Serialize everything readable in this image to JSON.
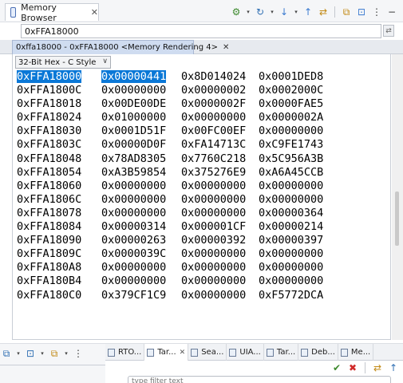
{
  "view": {
    "title": "Memory Browser",
    "close": "✕"
  },
  "address": {
    "value": "0xFFA18000"
  },
  "rendering_tab": {
    "label": "0xffa18000 - 0xFFA18000 <Memory Rendering 4>",
    "close": "✕"
  },
  "format": {
    "selected": "32-Bit Hex - C Style",
    "arrow": "∨"
  },
  "memory": {
    "rows": [
      {
        "addr": "0xFFA18000",
        "w0": "0x00000441",
        "w1": "0x8D014024",
        "w2": "0x0001DED8"
      },
      {
        "addr": "0xFFA1800C",
        "w0": "0x00000000",
        "w1": "0x00000002",
        "w2": "0x0002000C"
      },
      {
        "addr": "0xFFA18018",
        "w0": "0x00DE00DE",
        "w1": "0x0000002F",
        "w2": "0x0000FAE5"
      },
      {
        "addr": "0xFFA18024",
        "w0": "0x01000000",
        "w1": "0x00000000",
        "w2": "0x0000002A"
      },
      {
        "addr": "0xFFA18030",
        "w0": "0x0001D51F",
        "w1": "0x00FC00EF",
        "w2": "0x00000000"
      },
      {
        "addr": "0xFFA1803C",
        "w0": "0x00000D0F",
        "w1": "0xFA14713C",
        "w2": "0xC9FE1743"
      },
      {
        "addr": "0xFFA18048",
        "w0": "0x78AD8305",
        "w1": "0x7760C218",
        "w2": "0x5C956A3B"
      },
      {
        "addr": "0xFFA18054",
        "w0": "0xA3B59854",
        "w1": "0x375276E9",
        "w2": "0xA6A45CCB"
      },
      {
        "addr": "0xFFA18060",
        "w0": "0x00000000",
        "w1": "0x00000000",
        "w2": "0x00000000"
      },
      {
        "addr": "0xFFA1806C",
        "w0": "0x00000000",
        "w1": "0x00000000",
        "w2": "0x00000000"
      },
      {
        "addr": "0xFFA18078",
        "w0": "0x00000000",
        "w1": "0x00000000",
        "w2": "0x00000364"
      },
      {
        "addr": "0xFFA18084",
        "w0": "0x00000314",
        "w1": "0x000001CF",
        "w2": "0x00000214"
      },
      {
        "addr": "0xFFA18090",
        "w0": "0x00000263",
        "w1": "0x00000392",
        "w2": "0x00000397"
      },
      {
        "addr": "0xFFA1809C",
        "w0": "0x0000039C",
        "w1": "0x00000000",
        "w2": "0x00000000"
      },
      {
        "addr": "0xFFA180A8",
        "w0": "0x00000000",
        "w1": "0x00000000",
        "w2": "0x00000000"
      },
      {
        "addr": "0xFFA180B4",
        "w0": "0x00000000",
        "w1": "0x00000000",
        "w2": "0x00000000"
      },
      {
        "addr": "0xFFA180C0",
        "w0": "0x379CF1C9",
        "w1": "0x00000000",
        "w2": "0xF5772DCA"
      }
    ]
  },
  "bottom_tabs": [
    {
      "label": "RTO...",
      "close": ""
    },
    {
      "label": "Tar...",
      "close": "✕"
    },
    {
      "label": "Sea...",
      "close": ""
    },
    {
      "label": "UIA...",
      "close": ""
    },
    {
      "label": "Tar...",
      "close": ""
    },
    {
      "label": "Deb...",
      "close": ""
    },
    {
      "label": "Me...",
      "close": ""
    }
  ],
  "filter": {
    "placeholder": "type filter text"
  },
  "icons": {
    "gear": "⚙",
    "arrow_down": "▾",
    "refresh": "↻",
    "import": "↓",
    "export": "↑",
    "new_view": "⧉",
    "pin": "⊡",
    "menu": "⋮",
    "minimize": "−",
    "check": "✔",
    "remove": "✖",
    "link": "⇄"
  },
  "colors": {
    "selection": "#0a78d7",
    "accent_tab": "#cfdcf0"
  }
}
